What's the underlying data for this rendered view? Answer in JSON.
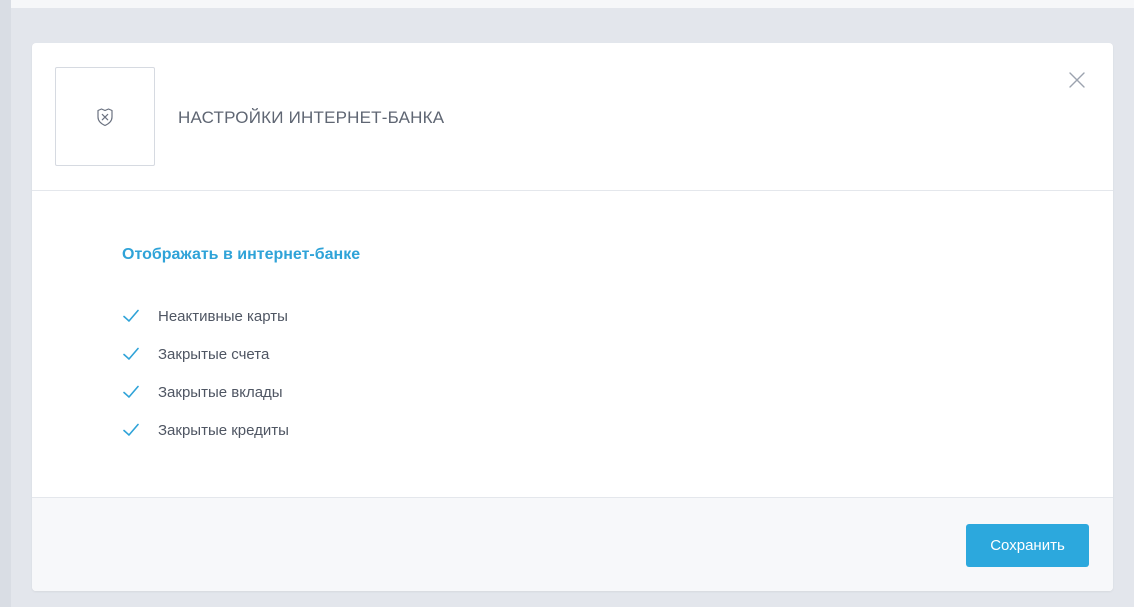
{
  "colors": {
    "accent": "#2fa3d8",
    "button": "#2ca8dd",
    "title_text": "#5f6673",
    "label_text": "#4f5663",
    "page_background": "#e3e6ec"
  },
  "modal": {
    "header_icon": "shield-x-icon",
    "title": "НАСТРОЙКИ ИНТЕРНЕТ-БАНКА",
    "close_icon": "close-icon"
  },
  "section": {
    "title": "Отображать в интернет-банке",
    "options": [
      {
        "label": "Неактивные карты",
        "checked": true
      },
      {
        "label": "Закрытые счета",
        "checked": true
      },
      {
        "label": "Закрытые вклады",
        "checked": true
      },
      {
        "label": "Закрытые кредиты",
        "checked": true
      }
    ]
  },
  "footer": {
    "save_label": "Сохранить"
  }
}
